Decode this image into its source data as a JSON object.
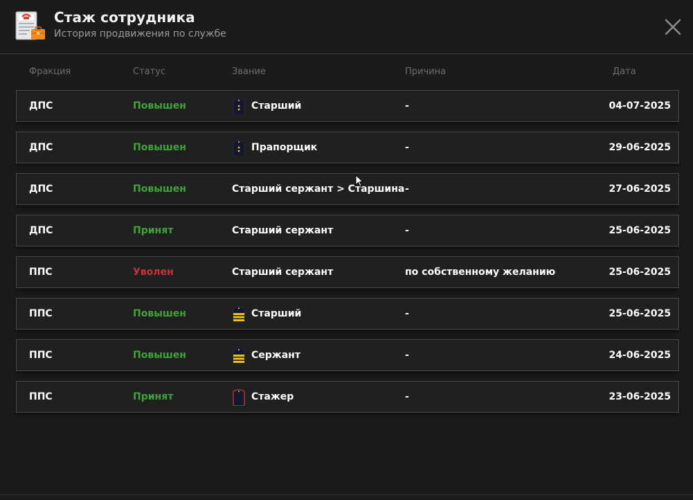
{
  "header": {
    "title": "Стаж сотрудника",
    "subtitle": "История продвижения по службе"
  },
  "columns": {
    "faction": "Фракция",
    "status": "Статус",
    "rank": "Звание",
    "reason": "Причина",
    "date": "Дата"
  },
  "rows": [
    {
      "faction": "ДПС",
      "status": "Повышен",
      "status_type": "promoted",
      "rank_icon": "dps-shoulder-icon",
      "rank": "Старший",
      "reason": "-",
      "date": "04-07-2025"
    },
    {
      "faction": "ДПС",
      "status": "Повышен",
      "status_type": "promoted",
      "rank_icon": "dps-shoulder-icon",
      "rank": "Прапорщик",
      "reason": "-",
      "date": "29-06-2025"
    },
    {
      "faction": "ДПС",
      "status": "Повышен",
      "status_type": "promoted",
      "rank_icon": "",
      "rank": "Старший сержант > Старшина",
      "reason": "-",
      "date": "27-06-2025"
    },
    {
      "faction": "ДПС",
      "status": "Принят",
      "status_type": "hired",
      "rank_icon": "",
      "rank": "Старший сержант",
      "reason": "-",
      "date": "25-06-2025"
    },
    {
      "faction": "ППС",
      "status": "Уволен",
      "status_type": "fired",
      "rank_icon": "",
      "rank": "Старший сержант",
      "reason": "по собственному желанию",
      "date": "25-06-2025"
    },
    {
      "faction": "ППС",
      "status": "Повышен",
      "status_type": "promoted",
      "rank_icon": "pps-stripes-icon",
      "rank": "Старший",
      "reason": "-",
      "date": "25-06-2025"
    },
    {
      "faction": "ППС",
      "status": "Повышен",
      "status_type": "promoted",
      "rank_icon": "pps-stripes-icon",
      "rank": "Сержант",
      "reason": "-",
      "date": "24-06-2025"
    },
    {
      "faction": "ППС",
      "status": "Принят",
      "status_type": "hired",
      "rank_icon": "trainee-shoulder-icon",
      "rank": "Стажер",
      "reason": "-",
      "date": "23-06-2025"
    }
  ],
  "colors": {
    "background": "#1b1b1b",
    "promoted": "#3fa33a",
    "fired": "#c9323a",
    "header_text": "#6e6e6e"
  }
}
